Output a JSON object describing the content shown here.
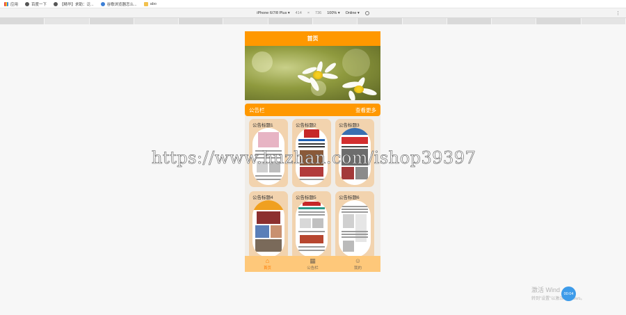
{
  "bookmarks": [
    {
      "label": "应用",
      "icon": "apps-icon"
    },
    {
      "label": "百度一下",
      "icon": "globe-icon"
    },
    {
      "label": "【精华】求助：泛...",
      "icon": "globe-icon"
    },
    {
      "label": "谷歌浏览器怎么...",
      "icon": "flower-icon"
    },
    {
      "label": "abo",
      "icon": "folder-icon"
    }
  ],
  "device_toolbar": {
    "device": "iPhone 6/7/8 Plus ▾",
    "width": "414",
    "times": "×",
    "height": "736",
    "zoom": "100% ▾",
    "network": "Online ▾",
    "menu": "⋮"
  },
  "app": {
    "header_title": "首页",
    "notice_bar": {
      "left": "公告栏",
      "right": "查看更多"
    },
    "cards": [
      {
        "title": "公告标题1"
      },
      {
        "title": "公告标题2"
      },
      {
        "title": "公告标题3"
      },
      {
        "title": "公告标题4"
      },
      {
        "title": "公告标题5"
      },
      {
        "title": "公告标题6"
      }
    ],
    "tabs": [
      {
        "label": "首页",
        "icon": "home-icon",
        "active": true
      },
      {
        "label": "公告栏",
        "icon": "notice-icon",
        "active": false
      },
      {
        "label": "我的",
        "icon": "user-icon",
        "active": false
      }
    ]
  },
  "watermark": "https://www.huzhan.com/ishop39397",
  "windows": {
    "line1": "激活 Wind",
    "line2": "转到\"设置\"以激活Windows。",
    "clock": "00:04"
  },
  "colors": {
    "accent": "#ff9800",
    "card": "#f2d3ae",
    "tabbar": "#fec87a"
  }
}
